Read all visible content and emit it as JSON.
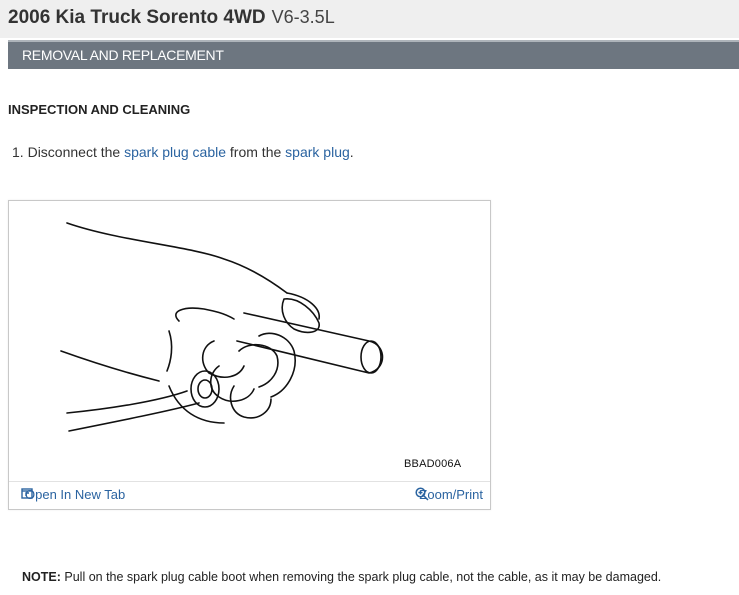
{
  "header": {
    "vehicle": "2006 Kia Truck Sorento 4WD",
    "engine": "V6-3.5L"
  },
  "section": {
    "title": "REMOVAL AND REPLACEMENT"
  },
  "content": {
    "subheading": "INSPECTION AND CLEANING",
    "step": {
      "number": "1.",
      "text_before": "Disconnect the",
      "link1": "spark plug cable",
      "text_middle": "from the",
      "link2": "spark plug",
      "text_after": "."
    }
  },
  "figure": {
    "code": "BBAD006A",
    "open_label": "Open In New Tab",
    "zoom_label": "Zoom/Print",
    "open_icon": "open-in-new-tab-icon",
    "zoom_icon": "magnifier-icon"
  },
  "note": {
    "label": "NOTE:",
    "text": "Pull on the spark plug cable boot when removing the spark plug cable, not the cable, as it may be damaged."
  },
  "colors": {
    "link": "#2a63a0",
    "section_bar": "#6d7680",
    "title_bar": "#efefef"
  }
}
